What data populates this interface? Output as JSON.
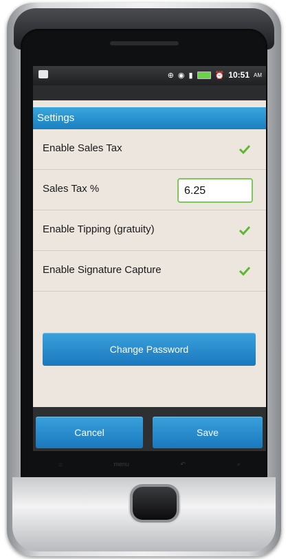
{
  "status_bar": {
    "time": "10:51",
    "ampm": "AM"
  },
  "screen": {
    "title": "Settings",
    "rows": [
      {
        "label": "Enable Sales Tax",
        "checked": true
      },
      {
        "label": "Sales Tax %",
        "value": "6.25"
      },
      {
        "label": "Enable Tipping (gratuity)",
        "checked": true
      },
      {
        "label": "Enable Signature Capture",
        "checked": true
      }
    ],
    "change_password_label": "Change Password",
    "cancel_label": "Cancel",
    "save_label": "Save"
  },
  "softkeys": {
    "home": "⌂",
    "menu": "menu",
    "back": "↶",
    "search": "⌕"
  },
  "colors": {
    "accent": "#1a7fc0",
    "check": "#5cb82e",
    "background": "#ece6df"
  }
}
